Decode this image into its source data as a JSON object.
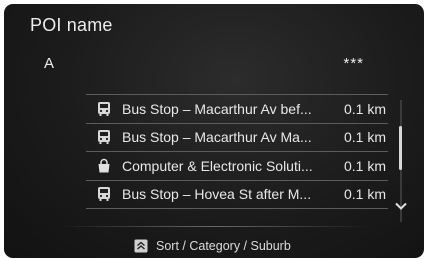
{
  "header": {
    "title": "POI name"
  },
  "input": {
    "typed": "A",
    "masked": "***"
  },
  "results": [
    {
      "icon": "bus-stop-icon",
      "name": "Bus Stop – Macarthur Av bef...",
      "distance": "0.1 km"
    },
    {
      "icon": "bus-stop-icon",
      "name": "Bus Stop – Macarthur Av Ma...",
      "distance": "0.1 km"
    },
    {
      "icon": "shopping-bag-icon",
      "name": "Computer & Electronic Soluti...",
      "distance": "0.1 km"
    },
    {
      "icon": "bus-stop-icon",
      "name": "Bus Stop – Hovea St after M...",
      "distance": "0.1 km"
    }
  ],
  "footer": {
    "sort_label": "Sort / Category / Suburb",
    "icon": "sort-options-icon"
  },
  "colors": {
    "background": "#1b1b1b",
    "text": "#ececec",
    "divider": "#5c5c5c"
  }
}
